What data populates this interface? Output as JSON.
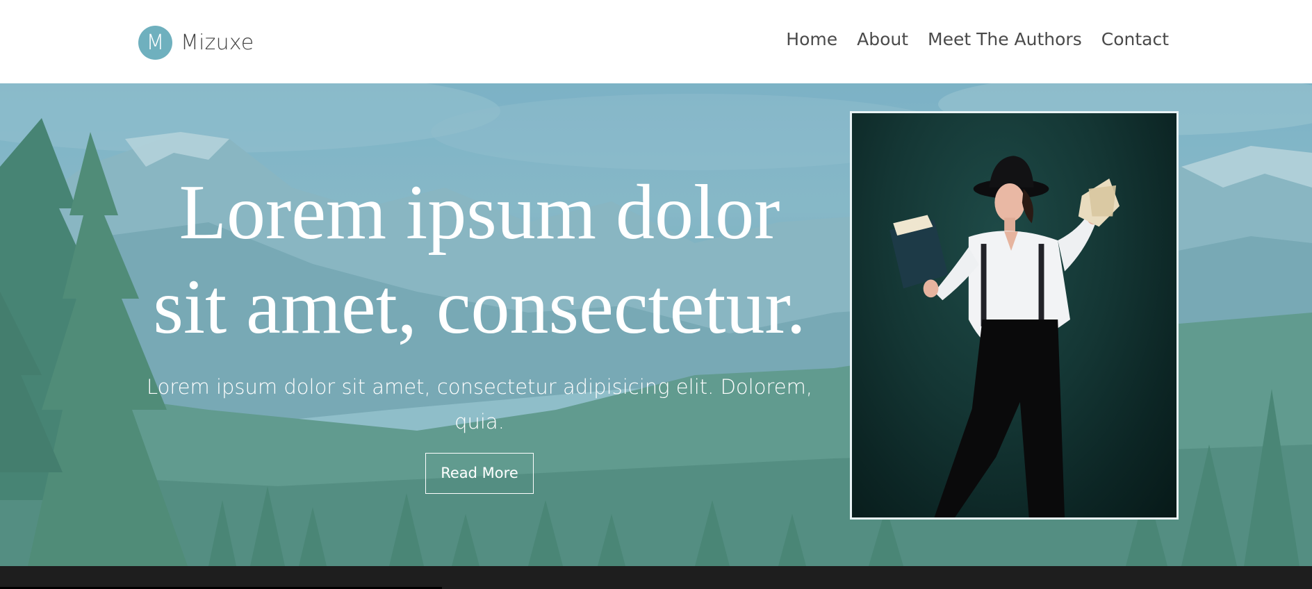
{
  "brand": {
    "logo_letter": "M",
    "name": "Mizuxe"
  },
  "nav": {
    "items": [
      {
        "label": "Home"
      },
      {
        "label": "About"
      },
      {
        "label": "Meet The Authors"
      },
      {
        "label": "Contact"
      }
    ]
  },
  "hero": {
    "title_line1": "Lorem ipsum dolor",
    "title_line2": "sit amet, consectetur.",
    "subtitle": "Lorem ipsum dolor sit amet, consectetur adipisicing elit. Dolorem, quia.",
    "button_label": "Read More"
  },
  "colors": {
    "brand_accent": "#6fb0be",
    "hero_overlay": "#6eafc3",
    "footer_bar": "#1e1e1e",
    "photo_border": "#e8f2f4"
  },
  "icons": {
    "logo": "letter-m-circle-logo"
  }
}
